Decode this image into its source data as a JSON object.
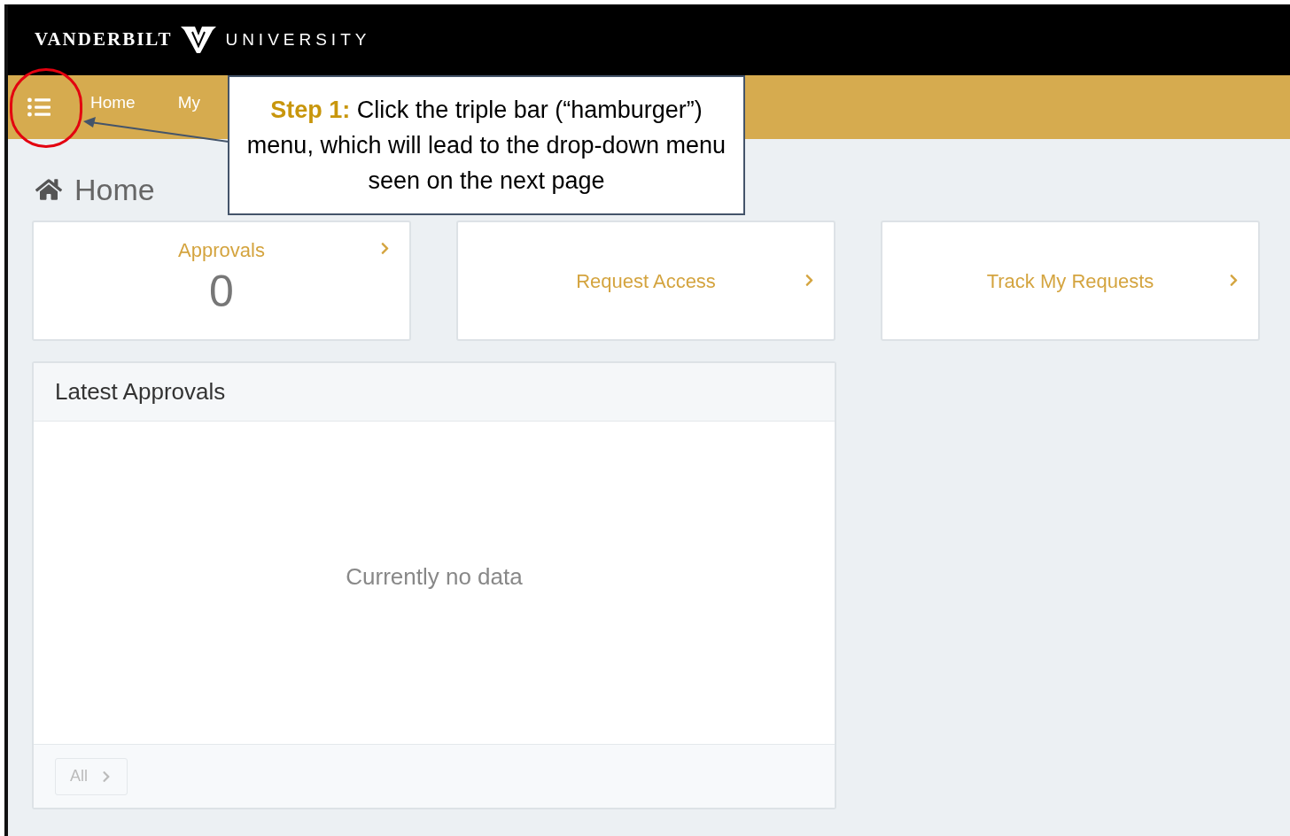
{
  "header": {
    "brand_left": "VANDERBILT",
    "brand_right": "UNIVERSITY"
  },
  "nav": {
    "items": [
      {
        "label": "Home"
      },
      {
        "label": "My"
      }
    ]
  },
  "page_title": "Home",
  "tiles": [
    {
      "title": "Approvals",
      "count": "0"
    },
    {
      "title": "Request Access"
    },
    {
      "title": "Track My Requests"
    }
  ],
  "panel": {
    "title": "Latest Approvals",
    "empty_text": "Currently no data",
    "footer_button": "All"
  },
  "callout": {
    "step_label": "Step 1:",
    "text": "Click the triple bar (“hamburger”) menu, which will lead to the drop-down menu seen on the next page"
  }
}
